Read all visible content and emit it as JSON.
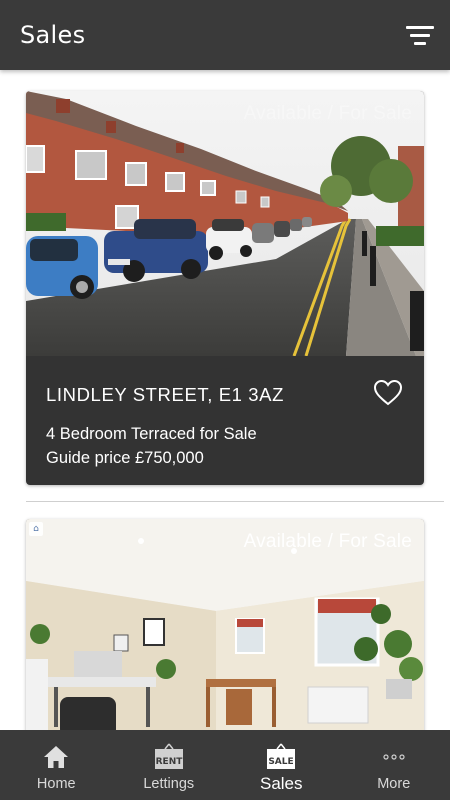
{
  "header": {
    "title": "Sales"
  },
  "listings": [
    {
      "status": "Available / For Sale",
      "address": "LINDLEY STREET, E1 3AZ",
      "description": "4 Bedroom Terraced for Sale",
      "price": "Guide price £750,000"
    },
    {
      "status": "Available / For Sale"
    }
  ],
  "nav": {
    "items": [
      {
        "label": "Home",
        "icon": "home-icon"
      },
      {
        "label": "Lettings",
        "icon": "rent-sign-icon",
        "badge": "RENT"
      },
      {
        "label": "Sales",
        "icon": "sale-sign-icon",
        "badge": "SALE",
        "active": true
      },
      {
        "label": "More",
        "icon": "more-dots-icon"
      }
    ]
  },
  "colors": {
    "bar": "#3a3a3a",
    "card": "#333333",
    "text": "#ffffff"
  }
}
